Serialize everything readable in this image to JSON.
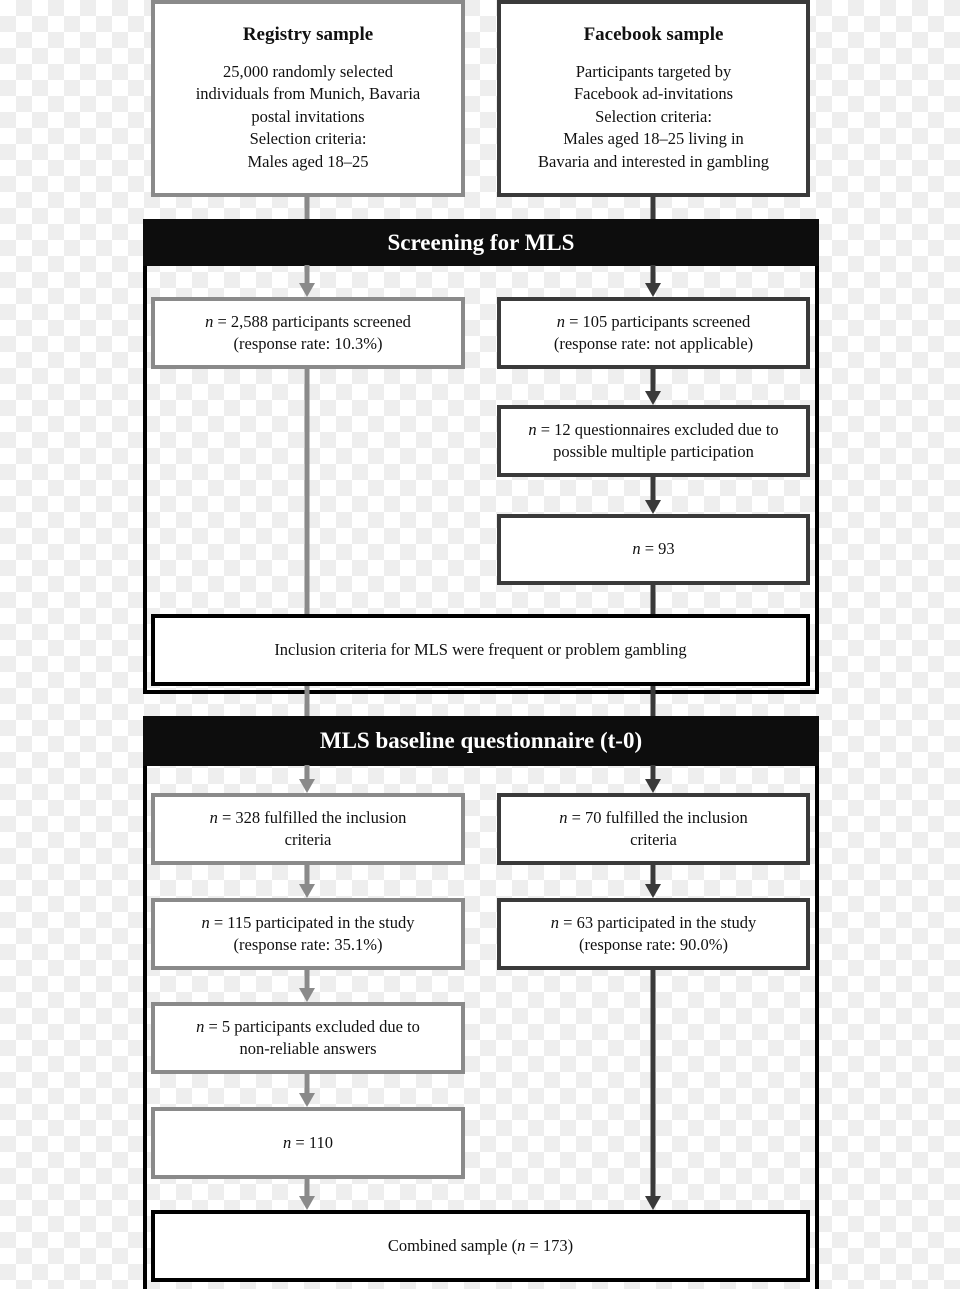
{
  "colors": {
    "registry": "#8a8a8a",
    "facebook": "#3a3a3a",
    "section": "#0d0d0d"
  },
  "registry": {
    "title": "Registry sample",
    "lines": [
      "25,000 randomly selected",
      "individuals from Munich, Bavaria",
      "postal invitations",
      "Selection criteria:",
      "Males aged 18–25"
    ]
  },
  "facebook": {
    "title": "Facebook sample",
    "lines": [
      "Participants targeted by",
      "Facebook ad-invitations",
      "Selection criteria:",
      "Males aged 18–25 living in",
      "Bavaria and interested in gambling"
    ]
  },
  "screening": {
    "header": "Screening for MLS",
    "reg_screened": {
      "n": "n",
      "rest": " = 2,588 participants screened",
      "line2": "(response rate: 10.3%)"
    },
    "fb_screened": {
      "n": "n",
      "rest": " = 105 participants screened",
      "line2": "(response rate: not applicable)"
    },
    "fb_excluded": {
      "n": "n",
      "rest": " = 12 questionnaires excluded due to",
      "line2": "possible multiple participation"
    },
    "fb_remaining": {
      "n": "n",
      "rest": " = 93"
    },
    "inclusion": "Inclusion criteria for MLS were frequent or problem gambling"
  },
  "baseline": {
    "header": "MLS baseline questionnaire (t-0)",
    "reg_fulfilled": {
      "n": "n",
      "rest": " = 328 fulfilled the inclusion",
      "line2": "criteria"
    },
    "fb_fulfilled": {
      "n": "n",
      "rest": " = 70 fulfilled the inclusion",
      "line2": "criteria"
    },
    "reg_participated": {
      "n": "n",
      "rest": " = 115 participated in the study",
      "line2": "(response rate: 35.1%)"
    },
    "fb_participated": {
      "n": "n",
      "rest": " = 63 participated in the study",
      "line2": "(response rate: 90.0%)"
    },
    "reg_excluded": {
      "n": "n",
      "rest": " = 5 participants excluded due to",
      "line2": "non-reliable answers"
    },
    "reg_remaining": {
      "n": "n",
      "rest": " = 110"
    },
    "combined": {
      "pre": "Combined sample (",
      "n": "n",
      "rest": " = 173)"
    }
  }
}
